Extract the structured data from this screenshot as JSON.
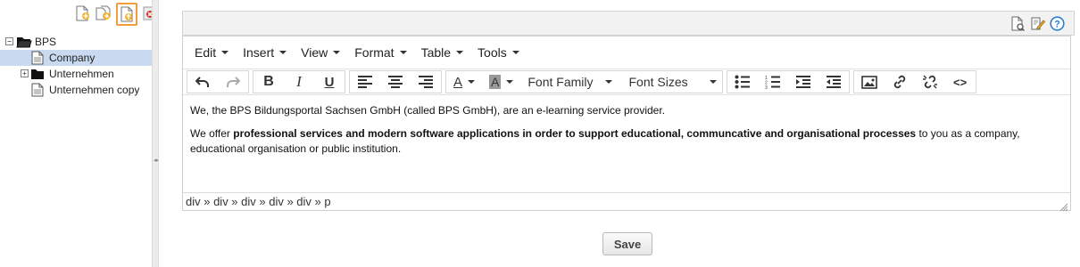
{
  "tree_toolbar": {
    "icons": [
      "new-page-icon",
      "copy-page-icon",
      "upload-page-icon",
      "delete-page-icon"
    ]
  },
  "tree": {
    "items": [
      {
        "label": "BPS",
        "expander": "−",
        "icon": "folder-open-icon"
      },
      {
        "label": "Company",
        "icon": "page-icon"
      },
      {
        "label": "Unternehmen",
        "expander": "+",
        "icon": "folder-icon"
      },
      {
        "label": "Unternehmen copy",
        "icon": "page-icon"
      }
    ]
  },
  "header_icons": [
    "preview-icon",
    "edit-icon",
    "help-icon"
  ],
  "editor": {
    "menu": [
      "Edit",
      "Insert",
      "View",
      "Format",
      "Table",
      "Tools"
    ],
    "toolbar": {
      "font_family": "Font Family",
      "font_sizes": "Font Sizes",
      "undo": "↶",
      "redo": "↷",
      "bold": "B",
      "italic": "I",
      "underline": "U",
      "text_color": "A",
      "bg_color": "A",
      "code": "<>"
    },
    "body": {
      "p1": "We, the BPS Bildungsportal Sachsen GmbH (called BPS GmbH), are an e-learning service provider.",
      "p2_prefix": "We offer ",
      "p2_bold": "professional services and modern software applications in order to support educational, communcative and organisational processes",
      "p2_suffix": " to you as a company, educational organisation or public institution."
    },
    "status_path": "div » div » div » div » div » p"
  },
  "save_label": "Save",
  "colors": {
    "accent_highlight": "#f39c3b",
    "selected_row": "#c9d9ef",
    "help_blue": "#2a7fd4"
  }
}
